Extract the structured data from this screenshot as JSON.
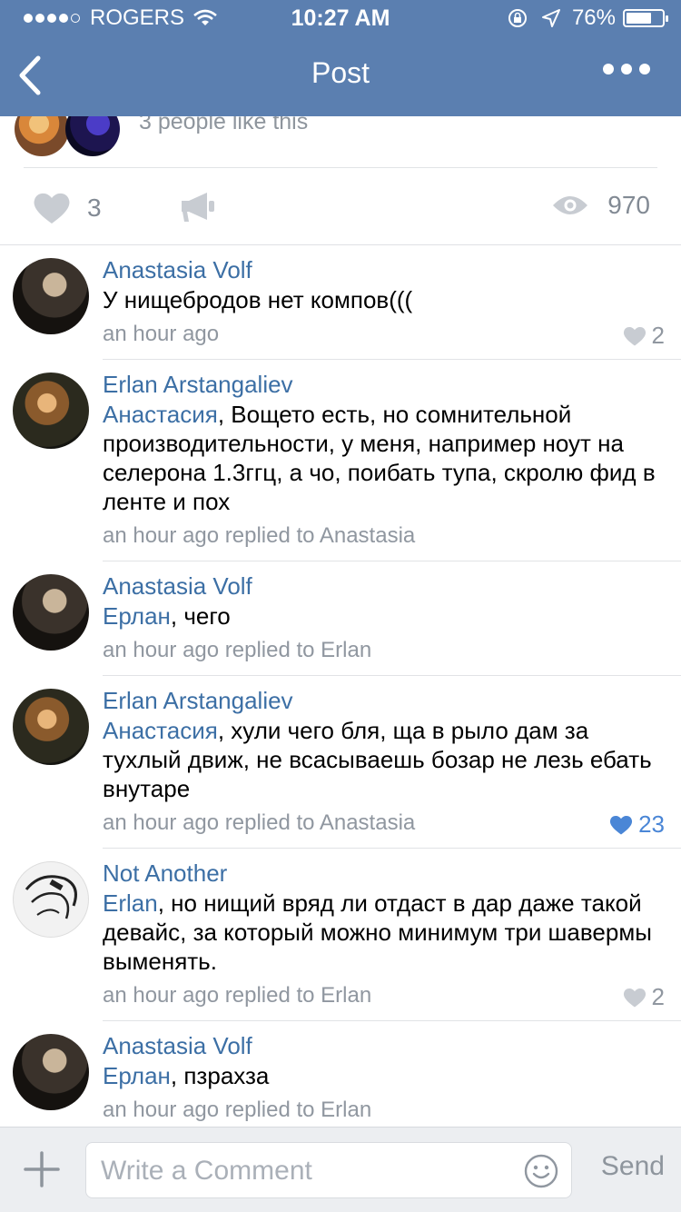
{
  "status_bar": {
    "carrier": "ROGERS",
    "time": "10:27 AM",
    "battery": "76%",
    "battery_level": 0.76
  },
  "nav": {
    "title": "Post"
  },
  "post": {
    "likers_text": "3 people like this",
    "likes_count": "3",
    "views_count": "970"
  },
  "comments": [
    {
      "name": "Anastasia Volf",
      "mention": "",
      "text": "У нищебродов нет компов(((",
      "meta": "an hour ago",
      "likes": "2",
      "liked": false
    },
    {
      "name": "Erlan Arstangaliev",
      "mention": "Анастасия",
      "text": ", Вощето есть, но сомнительной производительности, у меня, например ноут на селерона 1.3ггц, а чо, поибать тупа, скролю фид в ленте и пох",
      "meta": "an hour ago replied to Anastasia",
      "likes": "",
      "liked": false
    },
    {
      "name": "Anastasia Volf",
      "mention": "Ерлан",
      "text": ", чего",
      "meta": "an hour ago replied to Erlan",
      "likes": "",
      "liked": false
    },
    {
      "name": "Erlan Arstangaliev",
      "mention": "Анастасия",
      "text": ", хули чего бля, ща в рыло дам за тухлый движ, не всасываешь бозар не лезь ебать внутаре",
      "meta": "an hour ago replied to Anastasia",
      "likes": "23",
      "liked": true
    },
    {
      "name": "Not Another",
      "mention": "Erlan",
      "text": ", но нищий вряд ли отдаст в дар даже такой девайс, за который можно минимум три шавермы выменять.",
      "meta": "an hour ago replied to Erlan",
      "likes": "2",
      "liked": false
    },
    {
      "name": "Anastasia Volf",
      "mention": "Ерлан",
      "text": ", пзрахза",
      "meta": "an hour ago replied to Erlan",
      "likes": "",
      "liked": false
    }
  ],
  "compose": {
    "placeholder": "Write a Comment",
    "send_label": "Send"
  },
  "colors": {
    "header": "#5b7fb0",
    "link": "#3c6fa5",
    "liked": "#4a86d6",
    "muted": "#9097a0"
  }
}
